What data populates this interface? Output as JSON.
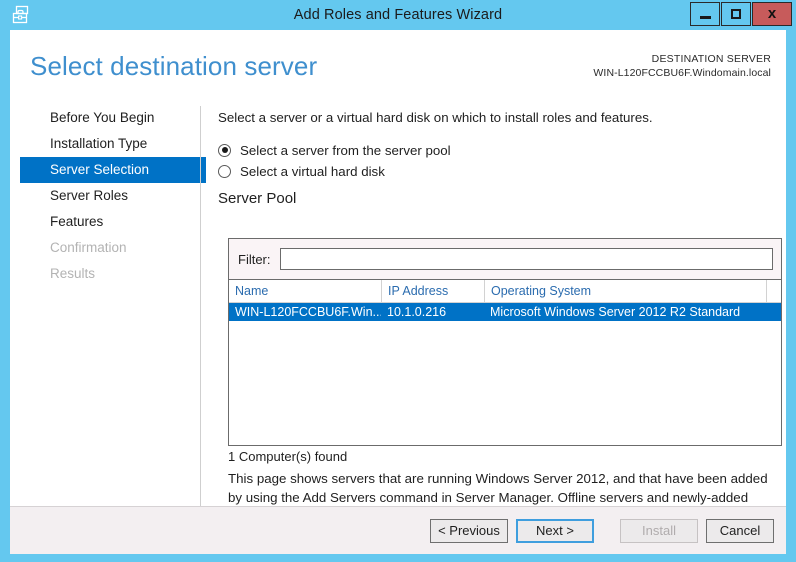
{
  "window": {
    "title": "Add Roles and Features Wizard",
    "icon": "server-toolbox-icon",
    "frame_color": "#64c8ef",
    "controls": {
      "minimize_label": "–",
      "maximize_label": "□",
      "close_label": "x"
    }
  },
  "header": {
    "page_title": "Select destination server",
    "destination_label": "DESTINATION SERVER",
    "destination_value": "WIN-L120FCCBU6F.Windomain.local"
  },
  "sidebar": {
    "items": [
      {
        "label": "Before You Begin",
        "state": "normal"
      },
      {
        "label": "Installation Type",
        "state": "normal"
      },
      {
        "label": "Server Selection",
        "state": "selected"
      },
      {
        "label": "Server Roles",
        "state": "normal"
      },
      {
        "label": "Features",
        "state": "normal"
      },
      {
        "label": "Confirmation",
        "state": "disabled"
      },
      {
        "label": "Results",
        "state": "disabled"
      }
    ],
    "selected_color": "#0072c6"
  },
  "main": {
    "intro": "Select a server or a virtual hard disk on which to install roles and features.",
    "radios": [
      {
        "label": "Select a server from the server pool",
        "checked": true
      },
      {
        "label": "Select a virtual hard disk",
        "checked": false
      }
    ],
    "server_pool_heading": "Server Pool",
    "filter": {
      "label": "Filter:",
      "value": "",
      "placeholder": ""
    },
    "table": {
      "columns": [
        "Name",
        "IP Address",
        "Operating System"
      ],
      "rows": [
        {
          "name": "WIN-L120FCCBU6F.Win...",
          "ip": "10.1.0.216",
          "os": "Microsoft Windows Server 2012 R2 Standard",
          "selected": true
        }
      ],
      "header_color": "#2b6caf",
      "selection_color": "#0072c6"
    },
    "found_text": "1 Computer(s) found",
    "help_text": "This page shows servers that are running Windows Server 2012, and that have been added by using the Add Servers command in Server Manager. Offline servers and newly-added servers from which data collection is still incomplete are not shown."
  },
  "footer": {
    "previous_label": "< Previous",
    "next_label": "Next >",
    "install_label": "Install",
    "cancel_label": "Cancel",
    "install_disabled": true,
    "next_focused": true
  }
}
